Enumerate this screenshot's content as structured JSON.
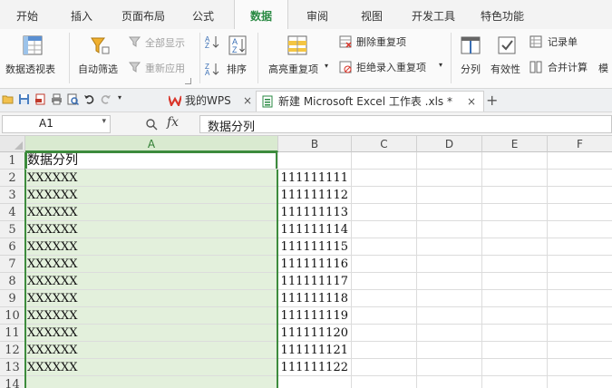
{
  "menu": {
    "tabs": [
      "开始",
      "插入",
      "页面布局",
      "公式",
      "数据",
      "审阅",
      "视图",
      "开发工具",
      "特色功能"
    ],
    "active": "数据"
  },
  "ribbon": {
    "pivot": "数据透视表",
    "autofilter": "自动筛选",
    "show_all": "全部显示",
    "reapply": "重新应用",
    "sort": "排序",
    "highlight_dup": "高亮重复项",
    "remove_dup": "删除重复项",
    "reject_dup": "拒绝录入重复项",
    "split": "分列",
    "validity": "有效性",
    "record": "记录单",
    "consolidate": "合并计算",
    "more": "模"
  },
  "doc_tabs": {
    "wps": "我的WPS",
    "file": "新建 Microsoft Excel 工作表 .xls *",
    "close": "×",
    "add": "+"
  },
  "formula_bar": {
    "cell_ref": "A1",
    "fx": "fx",
    "content": "数据分列"
  },
  "sheet": {
    "columns": [
      "A",
      "B",
      "C",
      "D",
      "E",
      "F"
    ],
    "rows": [
      {
        "n": "1",
        "a": "数据分列",
        "b": ""
      },
      {
        "n": "2",
        "a": "XXXXXX",
        "b": "111111111"
      },
      {
        "n": "3",
        "a": "XXXXXX",
        "b": "111111112"
      },
      {
        "n": "4",
        "a": "XXXXXX",
        "b": "111111113"
      },
      {
        "n": "5",
        "a": "XXXXXX",
        "b": "111111114"
      },
      {
        "n": "6",
        "a": "XXXXXX",
        "b": "111111115"
      },
      {
        "n": "7",
        "a": "XXXXXX",
        "b": "111111116"
      },
      {
        "n": "8",
        "a": "XXXXXX",
        "b": "111111117"
      },
      {
        "n": "9",
        "a": "XXXXXX",
        "b": "111111118"
      },
      {
        "n": "10",
        "a": "XXXXXX",
        "b": "111111119"
      },
      {
        "n": "11",
        "a": "XXXXXX",
        "b": "111111120"
      },
      {
        "n": "12",
        "a": "XXXXXX",
        "b": "111111121"
      },
      {
        "n": "13",
        "a": "XXXXXX",
        "b": "111111122"
      },
      {
        "n": "14",
        "a": "",
        "b": ""
      }
    ]
  },
  "colors": {
    "accent": "#2a8a43",
    "selection": "#e3f0dc",
    "wps_red": "#d9362b"
  }
}
